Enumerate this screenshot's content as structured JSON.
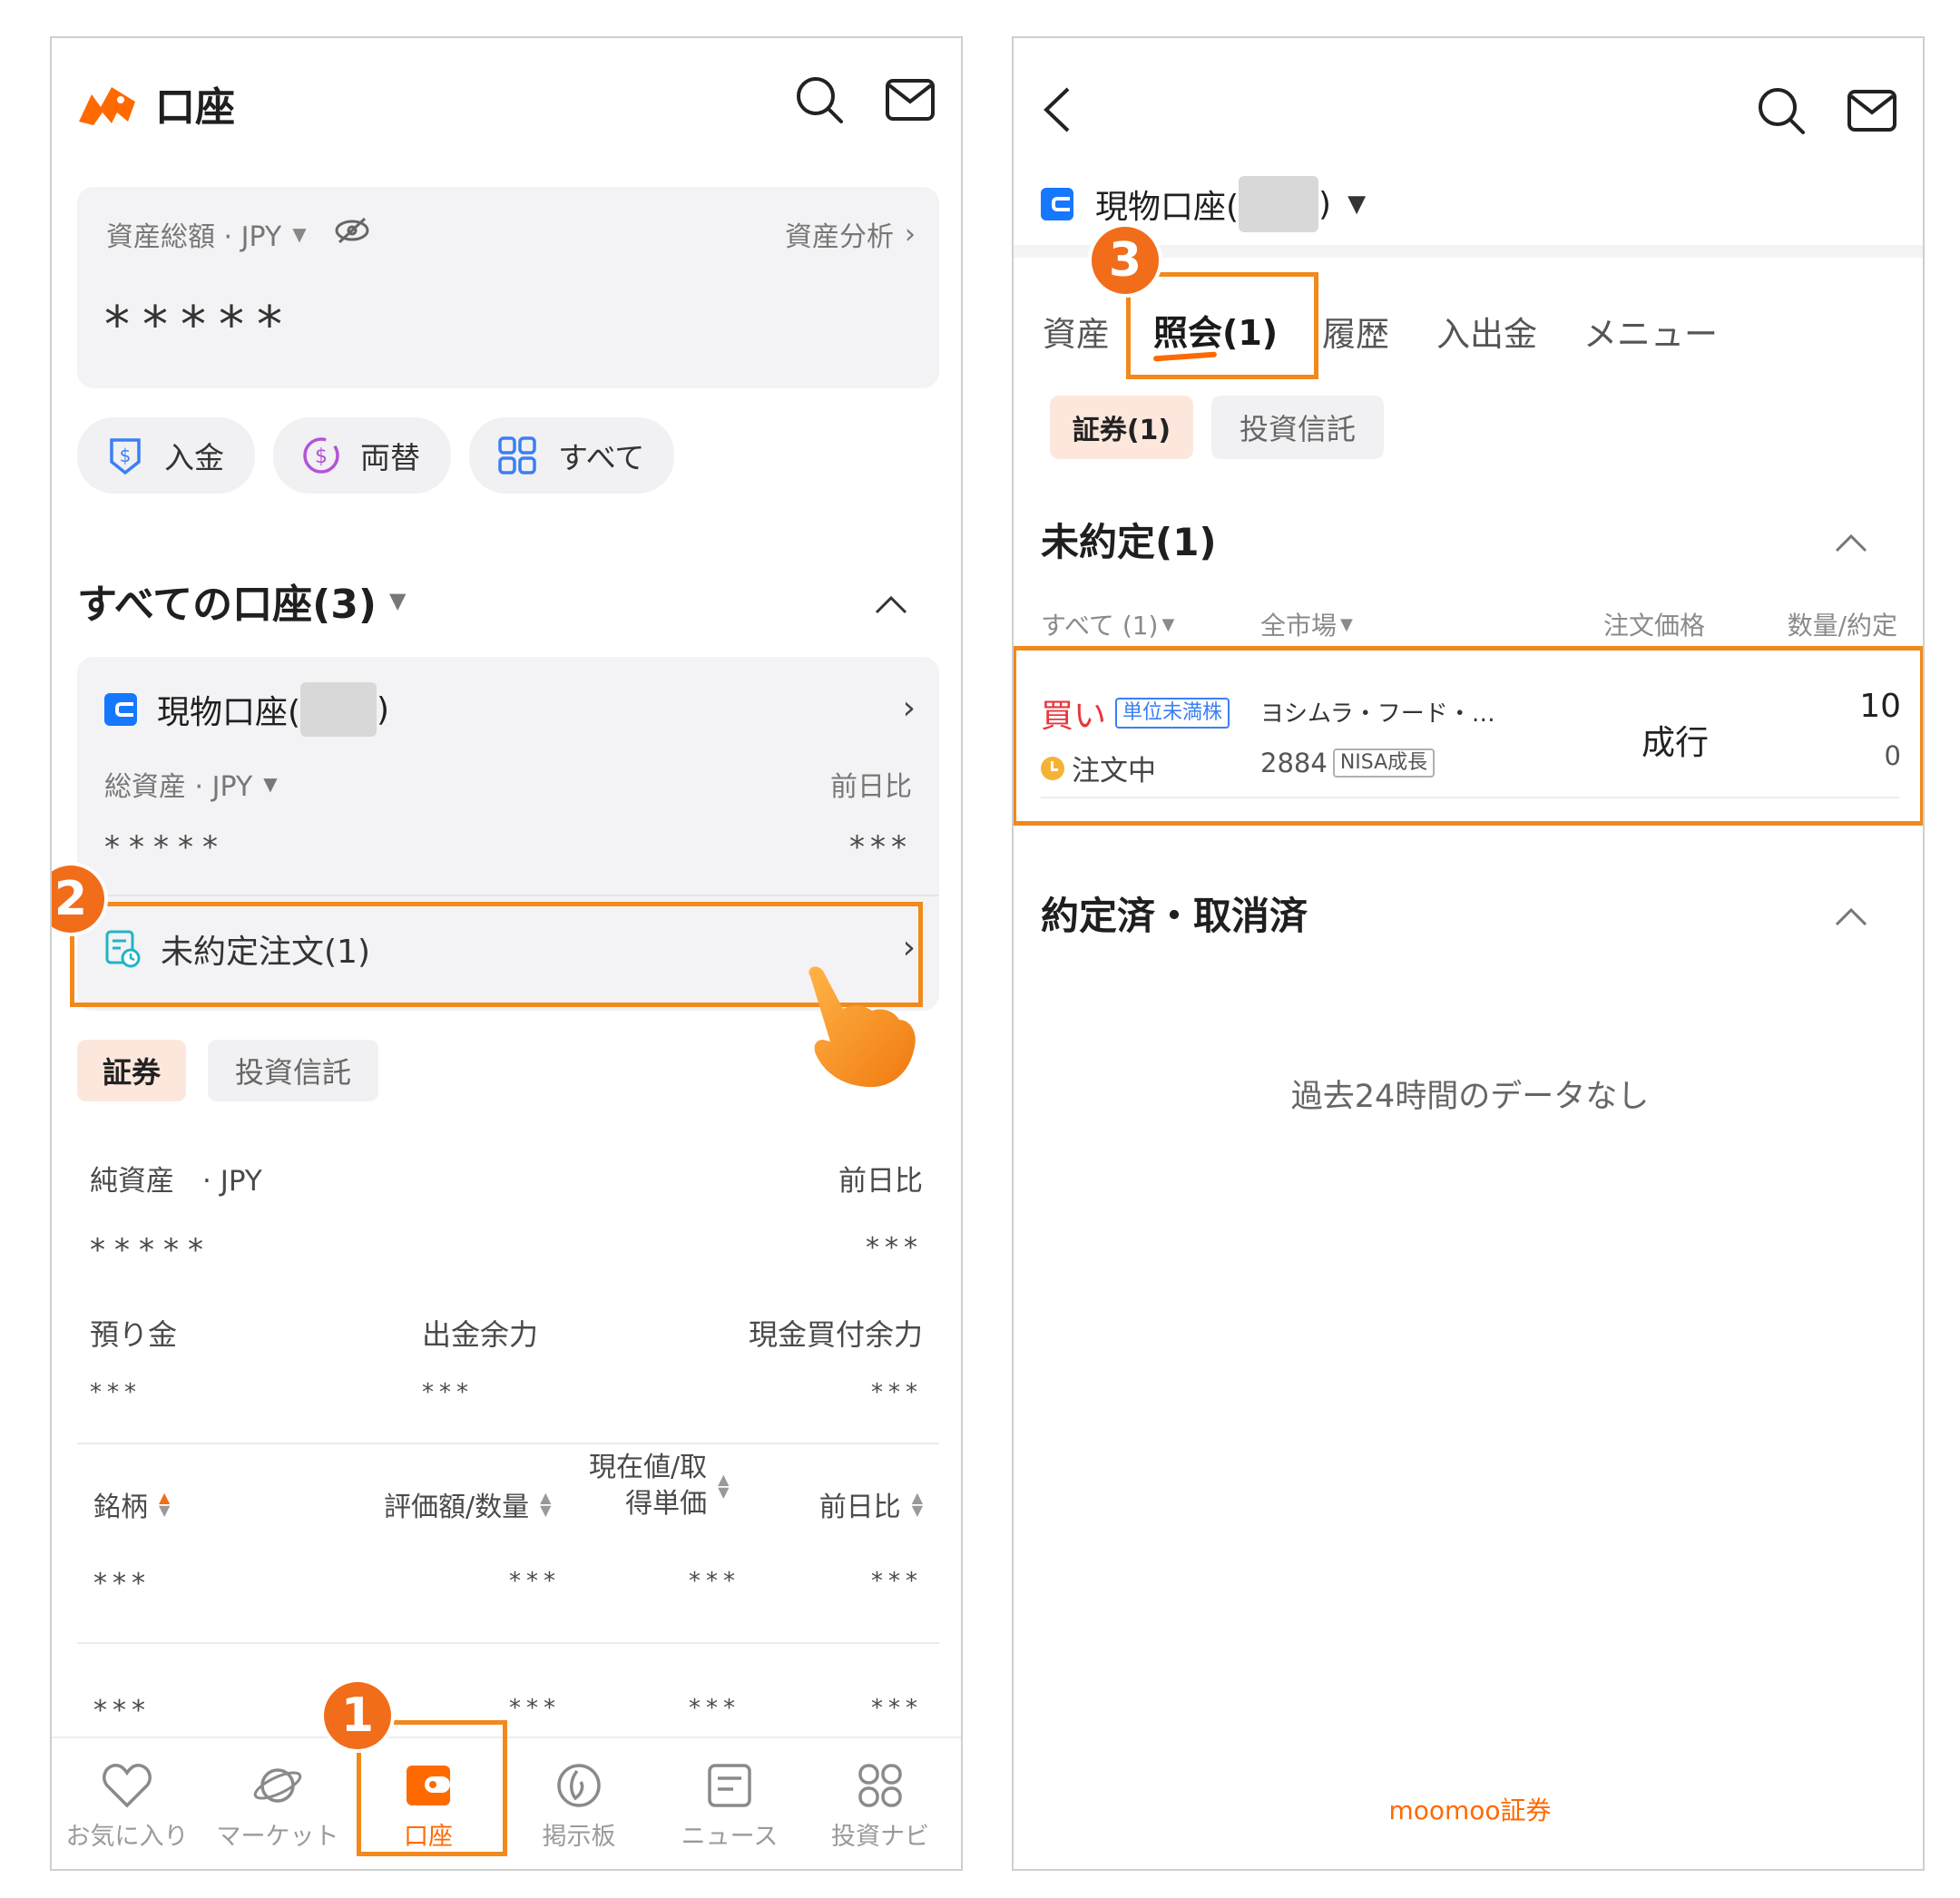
{
  "left": {
    "header": {
      "title": "口座"
    },
    "asset_card": {
      "label": "資産総額 · JPY",
      "analysis_link": "資産分析",
      "value_masked": "*****"
    },
    "actions": [
      {
        "label": "入金",
        "icon": "deposit-icon"
      },
      {
        "label": "両替",
        "icon": "exchange-icon"
      },
      {
        "label": "すべて",
        "icon": "grid-icon"
      }
    ],
    "accounts_section": {
      "title": "すべての口座(3)"
    },
    "account_card": {
      "name_prefix": "現物口座(",
      "name_suffix": ")",
      "total_label": "総資産 · JPY",
      "change_label": "前日比",
      "total_value": "*****",
      "change_value": "***",
      "pending_orders": "未約定注文(1)"
    },
    "sub_tabs": [
      "証券",
      "投資信託"
    ],
    "net_assets": {
      "label": "純資産　· JPY",
      "change_label": "前日比",
      "value": "*****",
      "change_value": "***"
    },
    "balances": {
      "deposit_label": "預り金",
      "withdraw_label": "出金余力",
      "buying_power_label": "現金買付余力",
      "deposit_value": "***",
      "withdraw_value": "***",
      "buying_power_value": "***"
    },
    "holdings_table": {
      "headers": [
        "銘柄",
        "評価額/数量",
        "現在値/取得単価",
        "前日比"
      ],
      "header_line1": "現在値/取",
      "header_line2": "得単価",
      "rows": [
        [
          "***",
          "***",
          "***",
          "***"
        ],
        [
          "***",
          "***",
          "***",
          "***"
        ]
      ]
    },
    "bottom_nav": [
      {
        "label": "お気に入り",
        "icon": "heart-icon"
      },
      {
        "label": "マーケット",
        "icon": "planet-icon"
      },
      {
        "label": "口座",
        "icon": "wallet-icon"
      },
      {
        "label": "掲示板",
        "icon": "board-icon"
      },
      {
        "label": "ニュース",
        "icon": "news-icon"
      },
      {
        "label": "投資ナビ",
        "icon": "navi-icon"
      }
    ],
    "active_nav": "口座"
  },
  "right": {
    "account_selector": {
      "prefix": "現物口座(",
      "suffix": ")"
    },
    "tabs": [
      "資産",
      "照会(1)",
      "履歴",
      "入出金",
      "メニュー"
    ],
    "active_tab": "照会(1)",
    "sub_tabs": [
      "証券(1)",
      "投資信託"
    ],
    "pending_section": {
      "title": "未約定(1)",
      "filters": {
        "side": "すべて (1)",
        "market": "全市場"
      },
      "columns": {
        "price": "注文価格",
        "qty": "数量/約定"
      }
    },
    "order": {
      "side": "買い",
      "unit_tag": "単位未満株",
      "name": "ヨシムラ・フード・…",
      "status": "注文中",
      "code": "2884",
      "account_tag": "NISA成長",
      "price": "成行",
      "qty": "10",
      "filled": "0"
    },
    "done_section": {
      "title": "約定済・取消済",
      "empty": "過去24時間のデータなし"
    },
    "footer_brand": "moomoo証券"
  },
  "steps": [
    "1",
    "2",
    "3"
  ],
  "colors": {
    "accent_orange": "#f2891c",
    "badge_orange": "#f16d1a",
    "brand_orange": "#ff6a00",
    "buy_red": "#e8363c",
    "account_blue": "#1677ff",
    "tag_blue": "#3b7ff5"
  }
}
